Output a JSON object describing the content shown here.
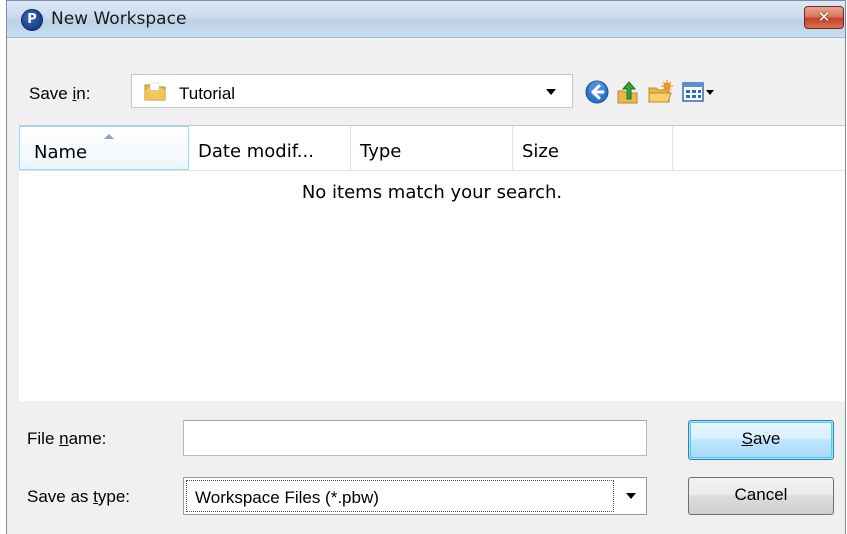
{
  "window": {
    "title": "New Workspace",
    "app_icon_letter": "P",
    "close_glyph": "✕"
  },
  "save_in": {
    "label_prefix": "Save ",
    "label_accel": "i",
    "label_suffix": "n:",
    "value": "Tutorial",
    "folder_icon": "folder-icon"
  },
  "toolbar": {
    "icons": [
      "back-icon",
      "up-folder-icon",
      "new-folder-icon",
      "view-menu-icon"
    ]
  },
  "file_list": {
    "columns": [
      "Name",
      "Date modif...",
      "Type",
      "Size"
    ],
    "sorted_column": "Name",
    "empty_message": "No items match your search."
  },
  "file_name": {
    "label_prefix": "File ",
    "label_accel": "n",
    "label_suffix": "ame:",
    "value": "",
    "placeholder": ""
  },
  "save_as_type": {
    "label_prefix": "Save as ",
    "label_accel": "t",
    "label_suffix": "ype:",
    "value": "Workspace Files (*.pbw)"
  },
  "buttons": {
    "save_accel": "S",
    "save_rest": "ave",
    "cancel": "Cancel"
  },
  "colors": {
    "title_bar": "#c7d9ec",
    "close_button": "#c4412a",
    "default_button_border": "#3c7fb1",
    "column_highlight": "#96d9f9"
  }
}
